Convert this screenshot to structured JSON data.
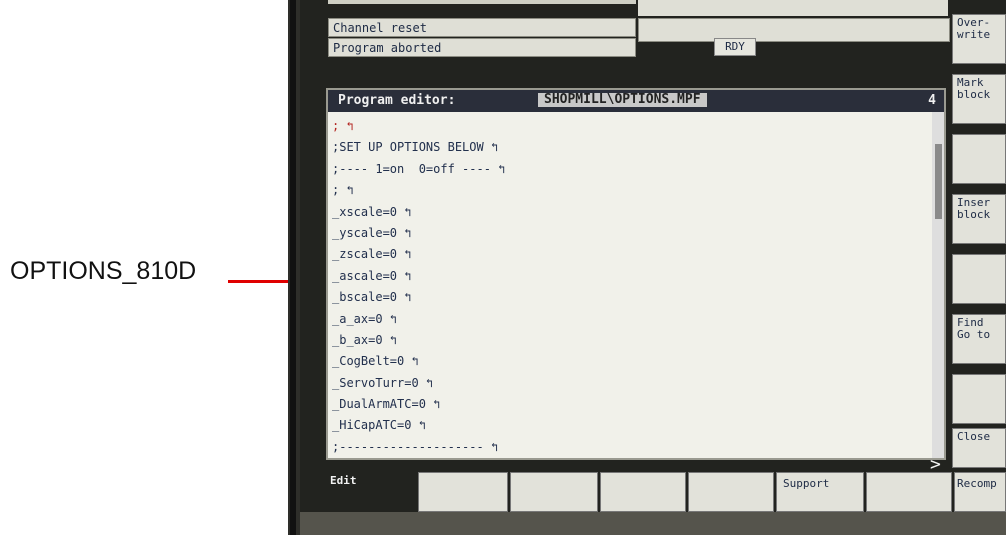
{
  "callout": {
    "label": "OPTIONS_810D"
  },
  "status": {
    "rows": [
      "Channel reset",
      "Program aborted"
    ],
    "ready": "RDY"
  },
  "editor": {
    "title": "Program editor:",
    "file": "SHOPMILL\\OPTIONS.MPF",
    "page": "4",
    "lines": [
      "; ↰",
      ";SET UP OPTIONS BELOW ↰",
      ";---- 1=on  0=off ---- ↰",
      "; ↰",
      "_xscale=0 ↰",
      "_yscale=0 ↰",
      "_zscale=0 ↰",
      "_ascale=0 ↰",
      "_bscale=0 ↰",
      "_a_ax=0 ↰",
      "_b_ax=0 ↰",
      "_CogBelt=0 ↰",
      "_ServoTurr=0 ↰",
      "_DualArmATC=0 ↰",
      "_HiCapATC=0 ↰",
      ";-------------------- ↰"
    ]
  },
  "vertical_softkeys": {
    "overwrite": "Over-\nwrite",
    "mark_block": "Mark\nblock",
    "insert_block": "Inser\nblock",
    "find_goto": "Find\nGo to",
    "close": "Close"
  },
  "horizontal_softkeys": {
    "edit": "Edit",
    "support": "Support",
    "recompile": "Recomp"
  }
}
